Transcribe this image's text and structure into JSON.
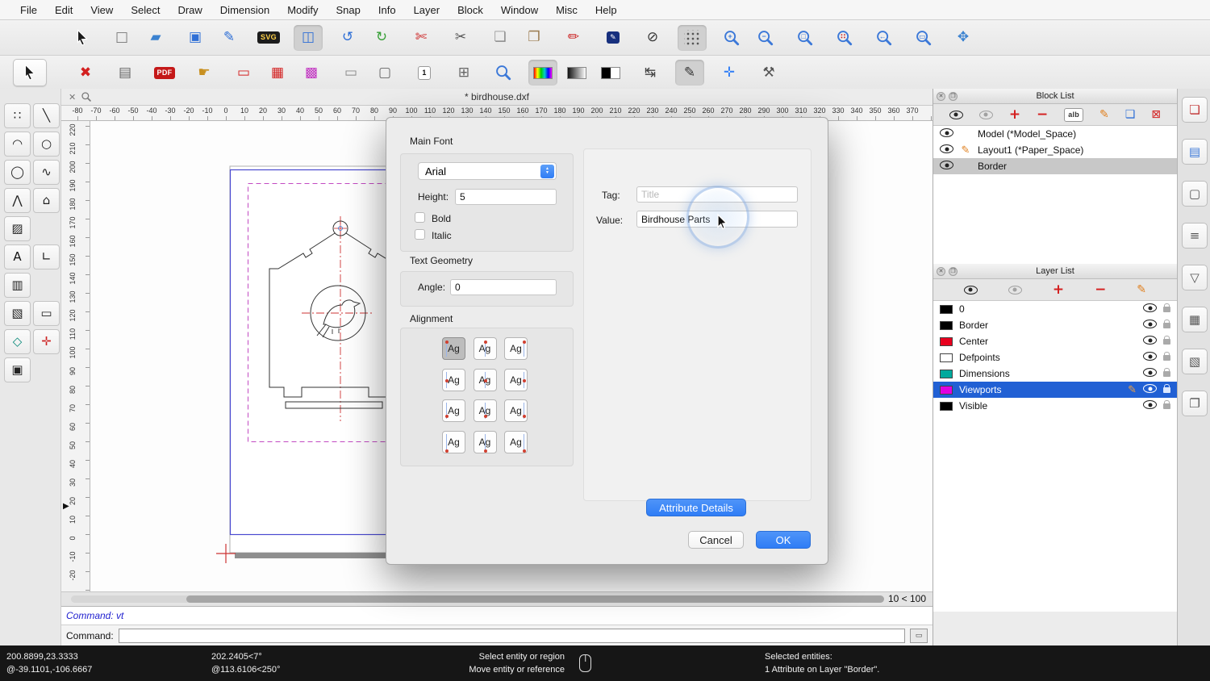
{
  "menubar": {
    "items": [
      "File",
      "Edit",
      "View",
      "Select",
      "Draw",
      "Dimension",
      "Modify",
      "Snap",
      "Info",
      "Layer",
      "Block",
      "Window",
      "Misc",
      "Help"
    ]
  },
  "glyphs": {
    "close": "✕",
    "float": "❐",
    "stepper_up": "▲",
    "stepper_down": "▼",
    "marker": "▶",
    "cmd_panel": "▭"
  },
  "toolbar1": {
    "groups": [
      [
        {
          "name": "select-arrow",
          "kind": "cursor"
        }
      ],
      [
        {
          "name": "new-file",
          "kind": "glyph",
          "glyph": "□",
          "color": "#777777"
        },
        {
          "name": "open-file",
          "kind": "glyph",
          "glyph": "▰",
          "color": "#3b82d0"
        }
      ],
      [
        {
          "name": "save-file",
          "kind": "glyph",
          "glyph": "▣",
          "color": "#2f6fd6"
        },
        {
          "name": "edit-drawing",
          "kind": "glyph",
          "glyph": "✎",
          "color": "#2f6fd6"
        }
      ],
      [
        {
          "name": "export-svg",
          "kind": "badge",
          "text": "SVG",
          "bg": "#1c1c1c",
          "fg": "#ffd24a"
        }
      ],
      [
        {
          "name": "print-preview",
          "kind": "glyph",
          "glyph": "◫",
          "color": "#2f6fd6",
          "selected": true
        }
      ],
      [
        {
          "name": "undo",
          "kind": "glyph",
          "glyph": "↺",
          "color": "#2f6fd6"
        },
        {
          "name": "redo",
          "kind": "glyph",
          "glyph": "↻",
          "color": "#38a038"
        }
      ],
      [
        {
          "name": "utility-knife",
          "kind": "glyph",
          "glyph": "✄",
          "color": "#cc2222"
        }
      ],
      [
        {
          "name": "cut",
          "kind": "glyph",
          "glyph": "✂",
          "color": "#555555"
        }
      ],
      [
        {
          "name": "copy",
          "kind": "glyph",
          "glyph": "❏",
          "color": "#8a8a8a"
        },
        {
          "name": "paste",
          "kind": "glyph",
          "glyph": "❐",
          "color": "#9a7b4f"
        }
      ],
      [
        {
          "name": "edit-attributes-pen",
          "kind": "glyph",
          "glyph": "✏",
          "color": "#cc2222"
        }
      ],
      [
        {
          "name": "edit-text-block",
          "kind": "badge",
          "text": "✎",
          "bg": "#17307e",
          "fg": "#ffffff"
        }
      ],
      [
        {
          "name": "toggle-construction",
          "kind": "glyph",
          "glyph": "⊘",
          "color": "#333333"
        }
      ],
      [
        {
          "name": "toggle-grid",
          "kind": "dots",
          "selected": true
        }
      ],
      [
        {
          "name": "zoom-in",
          "kind": "mag",
          "mod": "+"
        },
        {
          "name": "zoom-out",
          "kind": "mag",
          "mod": "−"
        }
      ],
      [
        {
          "name": "zoom-auto",
          "kind": "mag",
          "mod": "□"
        }
      ],
      [
        {
          "name": "zoom-selection",
          "kind": "mag",
          "mod": "∷",
          "mc": "#cc2222"
        }
      ],
      [
        {
          "name": "zoom-previous",
          "kind": "mag",
          "mod": "←"
        }
      ],
      [
        {
          "name": "zoom-window",
          "kind": "mag",
          "mod": "▭"
        }
      ],
      [
        {
          "name": "pan",
          "kind": "glyph",
          "glyph": "✥",
          "color": "#3b82d0"
        }
      ]
    ]
  },
  "toolbar2": {
    "groups": [
      [
        {
          "name": "select-arrow-2",
          "kind": "cursor",
          "boxed": true
        }
      ],
      [
        {
          "name": "close-drawing",
          "kind": "glyph",
          "glyph": "✖",
          "color": "#d32020"
        }
      ],
      [
        {
          "name": "print",
          "kind": "glyph",
          "glyph": "▤",
          "color": "#666666"
        }
      ],
      [
        {
          "name": "export-pdf",
          "kind": "badge",
          "text": "PDF",
          "bg": "#c41818",
          "fg": "#ffffff"
        }
      ],
      [
        {
          "name": "pan-hand",
          "kind": "glyph",
          "glyph": "☛",
          "color": "#c89020"
        }
      ],
      [
        {
          "name": "draw-border",
          "kind": "glyph",
          "glyph": "▭",
          "color": "#d32020"
        },
        {
          "name": "draw-grid-area",
          "kind": "glyph",
          "glyph": "▦",
          "color": "#d32020"
        },
        {
          "name": "draw-viewport",
          "kind": "glyph",
          "glyph": "▩",
          "color": "#c030c0"
        }
      ],
      [
        {
          "name": "window-rect",
          "kind": "glyph",
          "glyph": "▭",
          "color": "#888888"
        },
        {
          "name": "rounded-panel",
          "kind": "glyph",
          "glyph": "▢",
          "color": "#666666"
        }
      ],
      [
        {
          "name": "sheet-number",
          "kind": "badge",
          "text": "1",
          "bg": "#ffffff",
          "fg": "#111111",
          "border": true
        }
      ],
      [
        {
          "name": "table-grid",
          "kind": "glyph",
          "glyph": "⊞",
          "color": "#666666"
        }
      ],
      [
        {
          "name": "zoom-page",
          "kind": "mag",
          "mod": ""
        }
      ],
      [
        {
          "name": "color-palette",
          "kind": "bar",
          "bar": "rainbow",
          "selected": true
        },
        {
          "name": "gray-palette",
          "kind": "bar",
          "bar": "gray"
        },
        {
          "name": "bw-palette",
          "kind": "bar",
          "bar": "bw"
        }
      ],
      [
        {
          "name": "flip-direction",
          "kind": "glyph",
          "glyph": "↹",
          "color": "#444444"
        }
      ],
      [
        {
          "name": "line-style-pen",
          "kind": "glyph",
          "glyph": "✎",
          "color": "#333333",
          "selected": true
        }
      ],
      [
        {
          "name": "add-point",
          "kind": "glyph",
          "glyph": "✛",
          "color": "#2f7df6"
        }
      ],
      [
        {
          "name": "tools-settings",
          "kind": "glyph",
          "glyph": "⚒",
          "color": "#555555"
        }
      ]
    ]
  },
  "tool_palette": {
    "rows": [
      [
        {
          "name": "points",
          "glyph": "∷",
          "color": "#222222"
        },
        {
          "name": "lines",
          "glyph": "╲",
          "color": "#222222"
        }
      ],
      [
        {
          "name": "arcs",
          "glyph": "◠",
          "color": "#222222"
        },
        {
          "name": "circles",
          "glyph": "○",
          "color": "#222222"
        }
      ],
      [
        {
          "name": "ellipses",
          "glyph": "◯",
          "color": "#222222"
        },
        {
          "name": "splines",
          "glyph": "∿",
          "color": "#222222"
        }
      ],
      [
        {
          "name": "polylines",
          "glyph": "⋀",
          "color": "#222222"
        },
        {
          "name": "polygons",
          "glyph": "⌂",
          "color": "#222222"
        }
      ],
      [
        {
          "name": "hatch",
          "glyph": "▨",
          "color": "#222222"
        }
      ],
      [
        {
          "name": "text",
          "glyph": "A",
          "color": "#111111"
        },
        {
          "name": "dimensions",
          "glyph": "∟",
          "color": "#222222"
        }
      ],
      [
        {
          "name": "image",
          "glyph": "▥",
          "color": "#222222"
        }
      ],
      [
        {
          "name": "hatch-settings",
          "glyph": "▧",
          "color": "#222222"
        },
        {
          "name": "measure",
          "glyph": "▭",
          "color": "#222222"
        }
      ],
      [
        {
          "name": "shapes",
          "glyph": "◇",
          "color": "#0a8a7a"
        },
        {
          "name": "snap-tools",
          "glyph": "✛",
          "color": "#cc2222"
        }
      ],
      [
        {
          "name": "blocks",
          "glyph": "▣",
          "color": "#222222"
        }
      ]
    ]
  },
  "document": {
    "title": "* birdhouse.dxf",
    "zoom_indicator": "10 < 100"
  },
  "rulers": {
    "h_min": -80,
    "h_max": 370,
    "h_step": 10,
    "v_min": -20,
    "v_max": 230,
    "v_step": 10
  },
  "block_list": {
    "title": "Block List",
    "toolbar": [
      {
        "name": "show-all-blocks",
        "kind": "eye"
      },
      {
        "name": "hide-all-blocks",
        "kind": "eye",
        "dim": true
      },
      {
        "name": "add-block",
        "kind": "glyph",
        "glyph": "+",
        "color": "#d42020",
        "bold": true
      },
      {
        "name": "remove-block",
        "kind": "glyph",
        "glyph": "−",
        "color": "#d42020",
        "bold": true
      },
      {
        "name": "rename-block",
        "kind": "badge",
        "text": "alb",
        "bg": "#ffffff",
        "fg": "#333333",
        "border": true
      },
      {
        "name": "edit-block",
        "kind": "glyph",
        "glyph": "✎",
        "color": "#e08020",
        "size": 14
      },
      {
        "name": "insert-block",
        "kind": "glyph",
        "glyph": "❏",
        "color": "#2f6fd6",
        "size": 14
      },
      {
        "name": "delete-block",
        "kind": "glyph",
        "glyph": "⊠",
        "color": "#d42020",
        "size": 14
      }
    ],
    "items": [
      {
        "label": "Model (*Model_Space)",
        "edited": false,
        "selected": false
      },
      {
        "label": "Layout1 (*Paper_Space)",
        "edited": true,
        "selected": false
      },
      {
        "label": "Border",
        "edited": false,
        "selected": true
      }
    ]
  },
  "layer_list": {
    "title": "Layer List",
    "toolbar": [
      {
        "name": "show-all-layers",
        "kind": "eye"
      },
      {
        "name": "hide-all-layers",
        "kind": "eye",
        "dim": true
      },
      {
        "name": "add-layer",
        "kind": "glyph",
        "glyph": "+",
        "color": "#d42020",
        "bold": true
      },
      {
        "name": "remove-layer",
        "kind": "glyph",
        "glyph": "−",
        "color": "#d42020",
        "bold": true
      },
      {
        "name": "edit-layer",
        "kind": "glyph",
        "glyph": "✎",
        "color": "#e08020",
        "size": 14
      }
    ],
    "items": [
      {
        "label": "0",
        "color": "#000000",
        "selected": false
      },
      {
        "label": "Border",
        "color": "#000000",
        "selected": false
      },
      {
        "label": "Center",
        "color": "#e8001e",
        "selected": false
      },
      {
        "label": "Defpoints",
        "color": "#ffffff",
        "selected": false
      },
      {
        "label": "Dimensions",
        "color": "#00a99d",
        "selected": false
      },
      {
        "label": "Viewports",
        "color": "#e000e0",
        "selected": true
      },
      {
        "label": "Visible",
        "color": "#000000",
        "selected": false
      }
    ]
  },
  "right_strip": {
    "items": [
      {
        "name": "panel-block-list",
        "glyph": "❏",
        "color": "#c03030"
      },
      {
        "name": "panel-layer-list",
        "glyph": "▤",
        "color": "#3b78d8"
      },
      {
        "name": "panel-library",
        "glyph": "▢",
        "color": "#555555"
      },
      {
        "name": "panel-command-line",
        "glyph": "≡",
        "color": "#555555"
      },
      {
        "name": "panel-filter",
        "glyph": "▽",
        "color": "#555555"
      },
      {
        "name": "panel-properties",
        "glyph": "▦",
        "color": "#555555"
      },
      {
        "name": "panel-templates",
        "glyph": "▧",
        "color": "#555555"
      },
      {
        "name": "panel-clipboard",
        "glyph": "❐",
        "color": "#555555"
      }
    ]
  },
  "command": {
    "history": "Command: vt",
    "prompt": "Command:"
  },
  "status": {
    "coord_abs": "200.8899,23.3333",
    "coord_rel": "@-39.1101,-106.6667",
    "polar_abs": "202.2405<7°",
    "polar_rel": "@113.6106<250°",
    "hint_line1": "Select entity or region",
    "hint_line2": "Move entity or reference",
    "selected_label": "Selected entities:",
    "selected_value": "1 Attribute on Layer \"Border\"."
  },
  "dialog": {
    "main_font_label": "Main Font",
    "font_name": "Arial",
    "height_label": "Height:",
    "height_value": "5",
    "bold_label": "Bold",
    "italic_label": "Italic",
    "text_geometry_label": "Text Geometry",
    "angle_label": "Angle:",
    "angle_value": "0",
    "alignment_label": "Alignment",
    "alignment": {
      "sample": "Ag",
      "selected_index": 0
    },
    "tag_label": "Tag:",
    "tag_placeholder": "Title",
    "value_label": "Value:",
    "value_text": "Birdhouse Parts",
    "attribute_details_label": "Attribute Details",
    "cancel_label": "Cancel",
    "ok_label": "OK"
  },
  "colors": {
    "accent": "#2f7df6",
    "selection_blue": "#2160d4",
    "magenta": "#cc44cc",
    "red": "#cc2222"
  }
}
